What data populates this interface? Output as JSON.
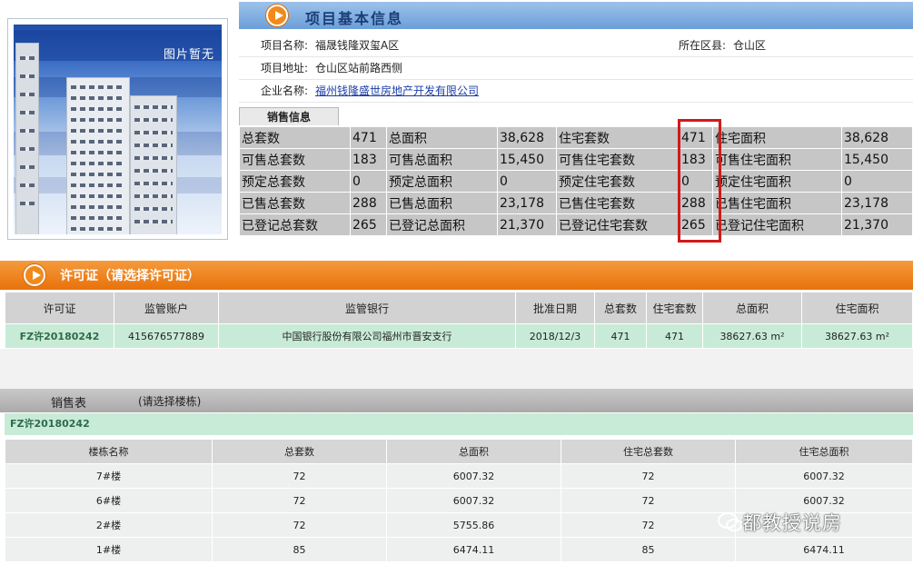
{
  "photo": {
    "placeholder": "图片暂无"
  },
  "project_info": {
    "title": "项目基本信息",
    "rows": [
      {
        "label": "项目名称:",
        "value": "福晟钱隆双玺A区",
        "label2": "所在区县:",
        "value2": "仓山区"
      },
      {
        "label": "项目地址:",
        "value": "仓山区站前路西侧"
      },
      {
        "label": "企业名称:",
        "value": "福州钱隆盛世房地产开发有限公司"
      }
    ]
  },
  "sales_info": {
    "tab": "销售信息",
    "rows": [
      [
        "总套数",
        "471",
        "总面积",
        "38,628",
        "住宅套数",
        "471",
        "住宅面积",
        "38,628"
      ],
      [
        "可售总套数",
        "183",
        "可售总面积",
        "15,450",
        "可售住宅套数",
        "183",
        "可售住宅面积",
        "15,450"
      ],
      [
        "预定总套数",
        "0",
        "预定总面积",
        "0",
        "预定住宅套数",
        "0",
        "预定住宅面积",
        "0"
      ],
      [
        "已售总套数",
        "288",
        "已售总面积",
        "23,178",
        "已售住宅套数",
        "288",
        "已售住宅面积",
        "23,178"
      ],
      [
        "已登记总套数",
        "265",
        "已登记总面积",
        "21,370",
        "已登记住宅套数",
        "265",
        "已登记住宅面积",
        "21,370"
      ]
    ]
  },
  "permit": {
    "title": "许可证（请选择许可证）",
    "headers": [
      "许可证",
      "监管账户",
      "监管银行",
      "批准日期",
      "总套数",
      "住宅套数",
      "总面积",
      "住宅面积"
    ],
    "row": [
      "FZ许20180242",
      "415676577889",
      "中国银行股份有限公司福州市晋安支行",
      "2018/12/3",
      "471",
      "471",
      "38627.63 m²",
      "38627.63 m²"
    ]
  },
  "sales_table": {
    "title": "销售表",
    "hint": "(请选择楼栋)",
    "permit_label": "FZ许20180242",
    "headers": [
      "楼栋名称",
      "总套数",
      "总面积",
      "住宅总套数",
      "住宅总面积"
    ],
    "rows": [
      [
        "7#楼",
        "72",
        "6007.32",
        "72",
        "6007.32"
      ],
      [
        "6#楼",
        "72",
        "6007.32",
        "72",
        "6007.32"
      ],
      [
        "2#楼",
        "72",
        "5755.86",
        "72",
        ""
      ],
      [
        "1#楼",
        "85",
        "6474.11",
        "85",
        "6474.11"
      ]
    ]
  },
  "watermark": "都教授说房",
  "colors": {
    "accent_orange": "#e8720b",
    "header_blue": "#6b9fd8",
    "highlight_red": "#d11a1a",
    "row_green": "#c8ebd7"
  }
}
